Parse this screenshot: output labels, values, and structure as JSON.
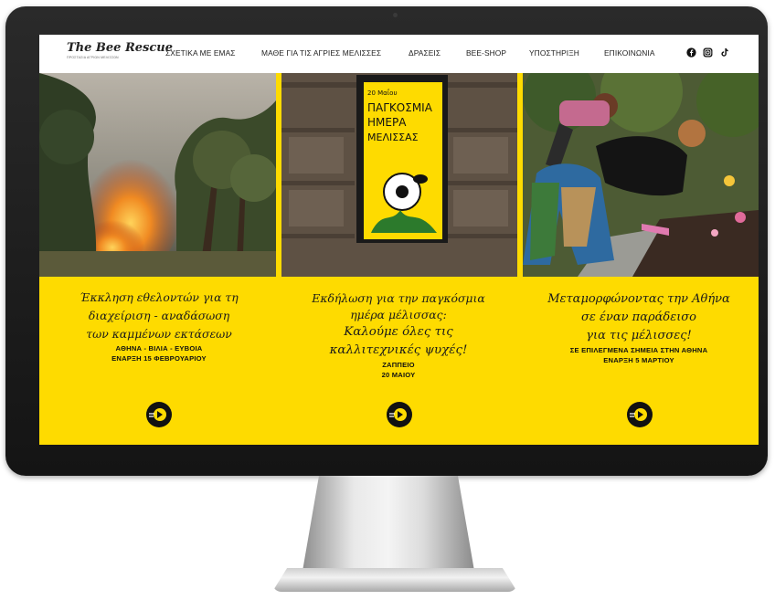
{
  "nav": {
    "logo_text": "The Bee Rescue",
    "logo_sub": "ΠΡΟΣΤΑΣΙΑ ΑΓΡΙΩΝ ΜΕΛΙΣΣΩΝ",
    "items": [
      {
        "label": "ΣΧΕΤΙΚΑ ΜΕ ΕΜΑΣ"
      },
      {
        "label": "ΜΑΘΕ ΓΙΑ ΤΙΣ ΑΓΡΙΕΣ ΜΕΛΙΣΣΕΣ"
      },
      {
        "label": "ΔΡΑΣΕΙΣ"
      },
      {
        "label": "BEE-SHOP"
      },
      {
        "label": "ΥΠΟΣΤΗΡΙΞΗ"
      },
      {
        "label": "ΕΠΙΚΟΙΝΩΝΙΑ"
      }
    ],
    "social_icons": [
      "facebook-icon",
      "instagram-icon",
      "tiktok-icon"
    ]
  },
  "poster": {
    "line1": "20 Μαΐου",
    "line2": "ΠΑΓΚΟΣΜΙΑ",
    "line3": "ΗΜΕΡΑ",
    "line4": "ΜΕΛΙΣΣΑΣ"
  },
  "panels": [
    {
      "script": [
        "Έκκληση εθελοντών για τη",
        "διαχείριση - αναδάσωση",
        "των καμμένων εκτάσεων"
      ],
      "caps": [
        "ΑΘΗΝΑ - ΒΙΛΙΑ - ΕΥΒΟΙΑ",
        "ΕΝΑΡΞΗ 15 ΦΕΒΡΟΥΑΡΙΟΥ"
      ]
    },
    {
      "script": [
        "Εκδήλωση για την παγκόσμια",
        "ημέρα μέλισσας:",
        "Καλούμε όλες τις",
        "καλλιτεχνικές ψυχές!"
      ],
      "caps": [
        "ΖΑΠΠΕΙΟ",
        "20 ΜΑΙΟΥ"
      ]
    },
    {
      "script": [
        "Μεταμορφώνοντας την Αθήνα",
        "σε έναν παράδεισο",
        "για τις μέλισσες!"
      ],
      "caps": [
        "ΣΕ ΕΠΙΛΕΓΜΕΝΑ ΣΗΜΕΙΑ ΣΤΗΝ ΑΘΗΝΑ",
        "ΕΝΑΡΞΗ 5 ΜΑΡΤΙΟΥ"
      ]
    }
  ],
  "colors": {
    "brand_yellow": "#fedb00",
    "text_dark": "#111111"
  }
}
